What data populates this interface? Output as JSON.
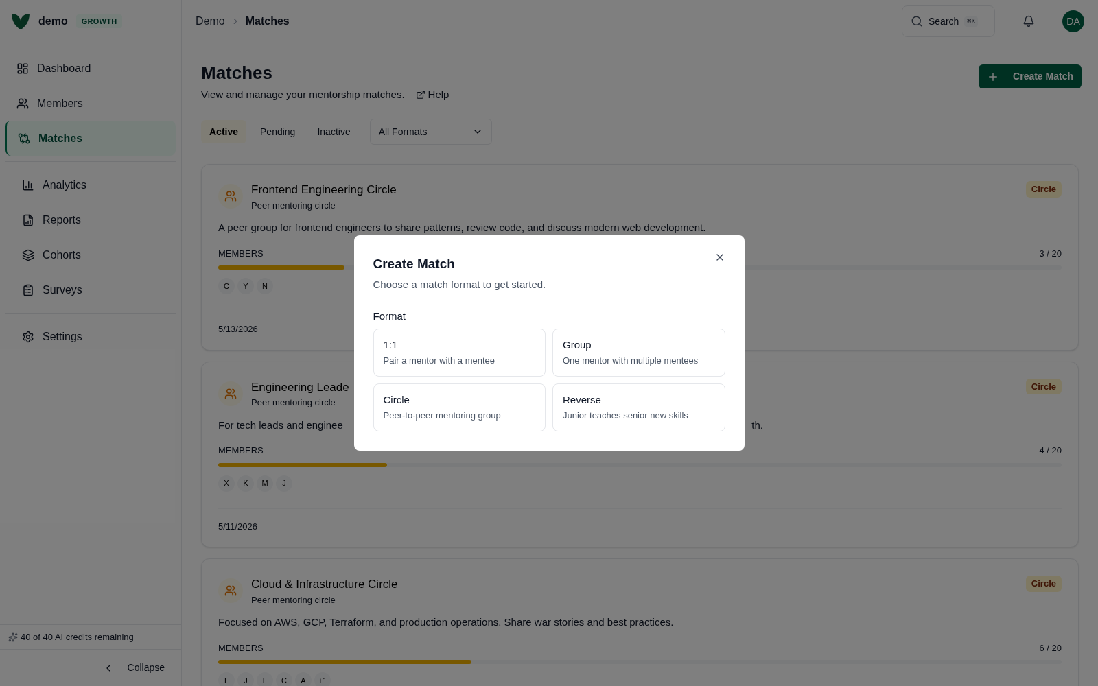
{
  "sidebar": {
    "brand": "demo",
    "plan": "GROWTH",
    "nav_groups": [
      [
        {
          "label": "Dashboard",
          "selected": false
        },
        {
          "label": "Members",
          "selected": false
        },
        {
          "label": "Matches",
          "selected": true
        }
      ],
      [
        {
          "label": "Analytics",
          "selected": false
        },
        {
          "label": "Reports",
          "selected": false
        },
        {
          "label": "Cohorts",
          "selected": false
        },
        {
          "label": "Surveys",
          "selected": false
        }
      ],
      [
        {
          "label": "Settings",
          "selected": false
        }
      ]
    ],
    "credits": "40 of 40 AI credits remaining",
    "collapse": "Collapse"
  },
  "header": {
    "breadcrumb": [
      "Demo",
      "Matches"
    ],
    "search": {
      "placeholder": "Search",
      "shortcut": "⌘K"
    },
    "avatar": "DA"
  },
  "page": {
    "title": "Matches",
    "subtitle": "View and manage your mentorship matches.",
    "help": "Help",
    "create_button": "Create Match",
    "tabs": [
      {
        "label": "Active",
        "selected": true
      },
      {
        "label": "Pending",
        "selected": false
      },
      {
        "label": "Inactive",
        "selected": false
      }
    ],
    "format_filter": "All Formats"
  },
  "cards": [
    {
      "title": "Frontend Engineering Circle",
      "subtitle": "Peer mentoring circle",
      "badge": "Circle",
      "description": "A peer group for frontend engineers to share patterns, review code, and discuss modern web development.",
      "members_label": "MEMBERS",
      "count": "3 / 20",
      "level": 0.15,
      "avatars": [
        "C",
        "Y",
        "N"
      ],
      "date": "5/13/2026"
    },
    {
      "title": "Engineering Leade",
      "subtitle": "Peer mentoring circle",
      "badge": "Circle",
      "description": "For tech leads and enginee",
      "description_end": "th.",
      "members_label": "MEMBERS",
      "count": "4 / 20",
      "level": 0.2,
      "avatars": [
        "X",
        "K",
        "M",
        "J"
      ],
      "date": "5/11/2026"
    },
    {
      "title": "Cloud & Infrastructure Circle",
      "subtitle": "Peer mentoring circle",
      "badge": "Circle",
      "description": "Focused on AWS, GCP, Terraform, and production operations. Share war stories and best practices.",
      "members_label": "MEMBERS",
      "count": "6 / 20",
      "level": 0.3,
      "avatars": [
        "L",
        "J",
        "F",
        "C",
        "A",
        "+1"
      ]
    }
  ],
  "modal": {
    "title": "Create Match",
    "subtitle": "Choose a match format to get started.",
    "format_label": "Format",
    "options": [
      {
        "title": "1:1",
        "description": "Pair a mentor with a mentee"
      },
      {
        "title": "Group",
        "description": "One mentor with multiple mentees"
      },
      {
        "title": "Circle",
        "description": "Peer-to-peer mentoring group"
      },
      {
        "title": "Reverse",
        "description": "Junior teaches senior new skills"
      }
    ]
  }
}
